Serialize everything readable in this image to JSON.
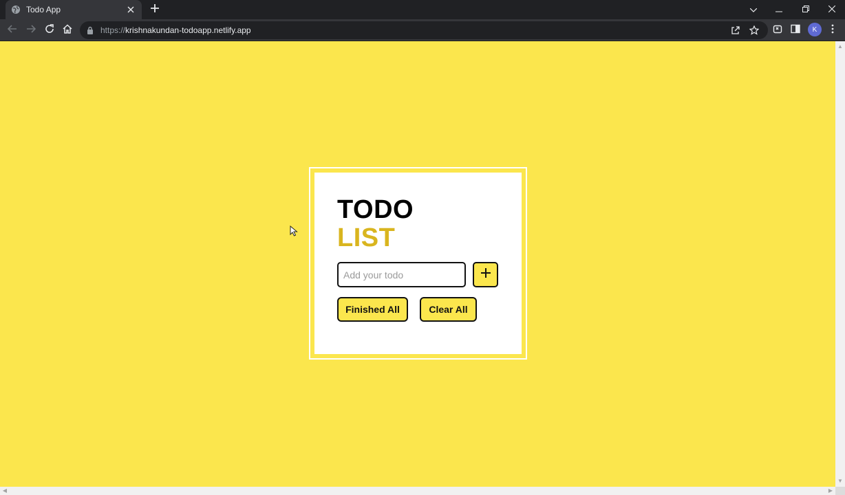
{
  "browser": {
    "tab_title": "Todo App",
    "url_scheme": "https://",
    "url_host": "krishnakundan-todoapp.netlify.app",
    "profile_initial": "K"
  },
  "app": {
    "title_line1": "TODO",
    "title_line2": "LIST",
    "input_placeholder": "Add your todo",
    "input_value": "",
    "add_symbol": "+",
    "finished_all_label": "Finished All",
    "clear_all_label": "Clear All"
  },
  "colors": {
    "background": "#fbe64d",
    "accent_text": "#d9b51f",
    "card": "#ffffff"
  },
  "icons": [
    "globe-icon",
    "close-icon",
    "plus-icon",
    "back-icon",
    "forward-icon",
    "reload-icon",
    "home-icon",
    "lock-icon",
    "share-icon",
    "star-icon",
    "extensions-icon",
    "sidepanel-icon",
    "menu-icon"
  ]
}
